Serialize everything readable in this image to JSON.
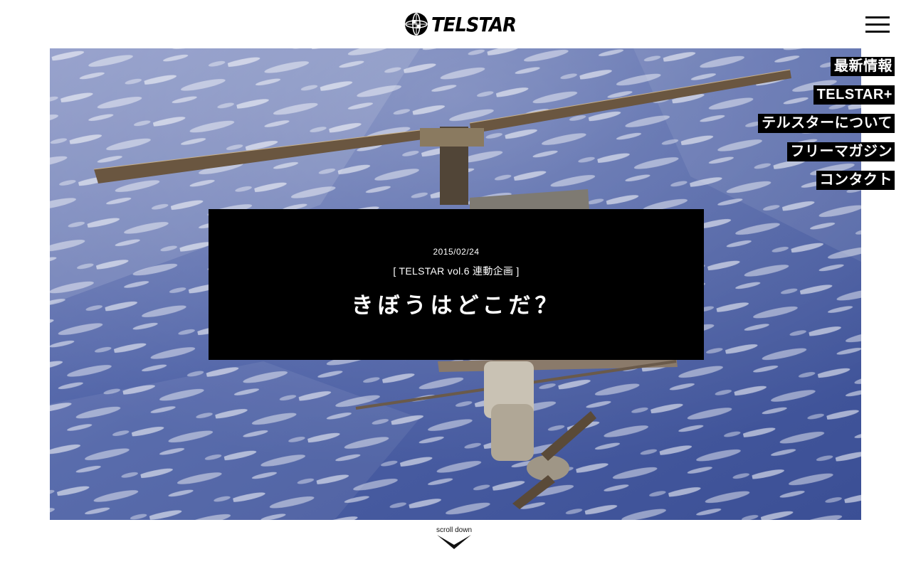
{
  "header": {
    "logo_text": "TELSTAR",
    "logo_icon": "soccer-ball-icon",
    "menu_icon": "hamburger-menu-icon"
  },
  "nav": {
    "items": [
      {
        "label": "最新情報"
      },
      {
        "label": "TELSTAR+"
      },
      {
        "label": "テルスターについて"
      },
      {
        "label": "フリーマガジン"
      },
      {
        "label": "コンタクト"
      }
    ]
  },
  "feature": {
    "date": "2015/02/24",
    "category": "[ TELSTAR vol.6 連動企画 ]",
    "title": "きぼうはどこだ？"
  },
  "scroll": {
    "label": "scroll down",
    "icon": "chevron-down-icon"
  },
  "colors": {
    "background": "#ffffff",
    "overlay": "#000000",
    "text_inverse": "#ffffff",
    "sky": "#4f63a3"
  }
}
